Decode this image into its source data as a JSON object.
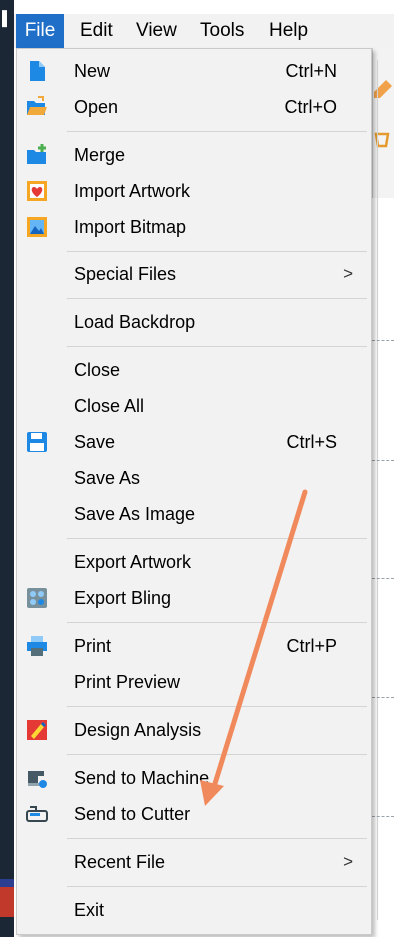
{
  "menubar": {
    "items": [
      {
        "label": "File",
        "active": true
      },
      {
        "label": "Edit"
      },
      {
        "label": "View"
      },
      {
        "label": "Tools"
      },
      {
        "label": "Help"
      }
    ]
  },
  "file_menu": {
    "items": [
      {
        "label": "New",
        "shortcut": "Ctrl+N",
        "icon": "new-file-icon"
      },
      {
        "label": "Open",
        "shortcut": "Ctrl+O",
        "icon": "open-folder-icon"
      },
      {
        "label": "Merge",
        "icon": "merge-folder-icon"
      },
      {
        "label": "Import Artwork",
        "icon": "import-artwork-icon"
      },
      {
        "label": "Import Bitmap",
        "icon": "import-bitmap-icon"
      },
      {
        "label": "Special Files",
        "submenu": true,
        "arrow": ">"
      },
      {
        "label": "Load Backdrop"
      },
      {
        "label": "Close"
      },
      {
        "label": "Close All"
      },
      {
        "label": "Save",
        "shortcut": "Ctrl+S",
        "icon": "save-disk-icon"
      },
      {
        "label": "Save As"
      },
      {
        "label": "Save As Image"
      },
      {
        "label": "Export Artwork"
      },
      {
        "label": "Export Bling",
        "icon": "export-bling-icon"
      },
      {
        "label": "Print",
        "shortcut": "Ctrl+P",
        "icon": "printer-icon"
      },
      {
        "label": "Print Preview"
      },
      {
        "label": "Design Analysis",
        "icon": "design-analysis-icon"
      },
      {
        "label": "Send to Machine",
        "icon": "sewing-machine-icon"
      },
      {
        "label": "Send to Cutter",
        "icon": "cutter-icon"
      },
      {
        "label": "Recent File",
        "submenu": true,
        "arrow": ">"
      },
      {
        "label": "Exit"
      }
    ]
  },
  "colors": {
    "menu_bg": "#f2f2f2",
    "active_menu": "#1f6fc9",
    "annotation_arrow": "#f08a5d"
  }
}
